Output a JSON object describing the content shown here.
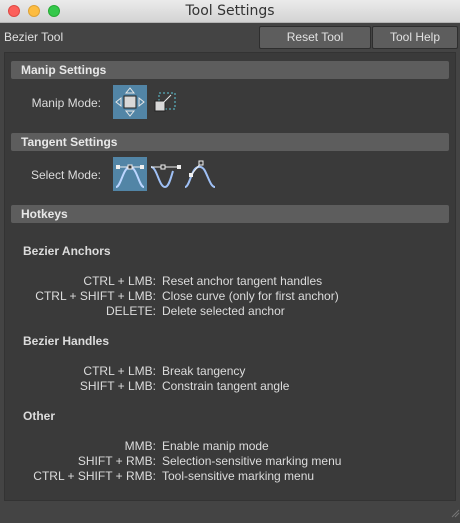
{
  "window": {
    "title": "Tool Settings"
  },
  "header": {
    "tool_name": "Bezier Tool",
    "reset_label": "Reset Tool",
    "help_label": "Tool Help"
  },
  "manip": {
    "header": "Manip Settings",
    "label": "Manip Mode:",
    "options": [
      {
        "icon": "move-manip-icon",
        "selected": true
      },
      {
        "icon": "transform-manip-icon",
        "selected": false
      }
    ]
  },
  "tangent": {
    "header": "Tangent Settings",
    "label": "Select Mode:",
    "options": [
      {
        "icon": "select-single-curve-icon",
        "selected": true
      },
      {
        "icon": "select-double-curve-icon",
        "selected": false
      },
      {
        "icon": "select-single-tangent-icon",
        "selected": false
      }
    ]
  },
  "hotkeys": {
    "header": "Hotkeys",
    "groups": [
      {
        "title": "Bezier Anchors",
        "items": [
          {
            "key": "CTRL + LMB:",
            "desc": "Reset anchor tangent handles"
          },
          {
            "key": "CTRL + SHIFT + LMB:",
            "desc": "Close curve (only for first anchor)"
          },
          {
            "key": "DELETE:",
            "desc": "Delete selected anchor"
          }
        ]
      },
      {
        "title": "Bezier Handles",
        "items": [
          {
            "key": "CTRL + LMB:",
            "desc": "Break tangency"
          },
          {
            "key": "SHIFT + LMB:",
            "desc": "Constrain tangent angle"
          }
        ]
      },
      {
        "title": "Other",
        "items": [
          {
            "key": "MMB:",
            "desc": "Enable manip mode"
          },
          {
            "key": "SHIFT + RMB:",
            "desc": "Selection-sensitive marking menu"
          },
          {
            "key": "CTRL + SHIFT + RMB:",
            "desc": "Tool-sensitive marking menu"
          }
        ]
      }
    ]
  },
  "colors": {
    "selected_accent": "#5285a6",
    "background": "#444444"
  }
}
